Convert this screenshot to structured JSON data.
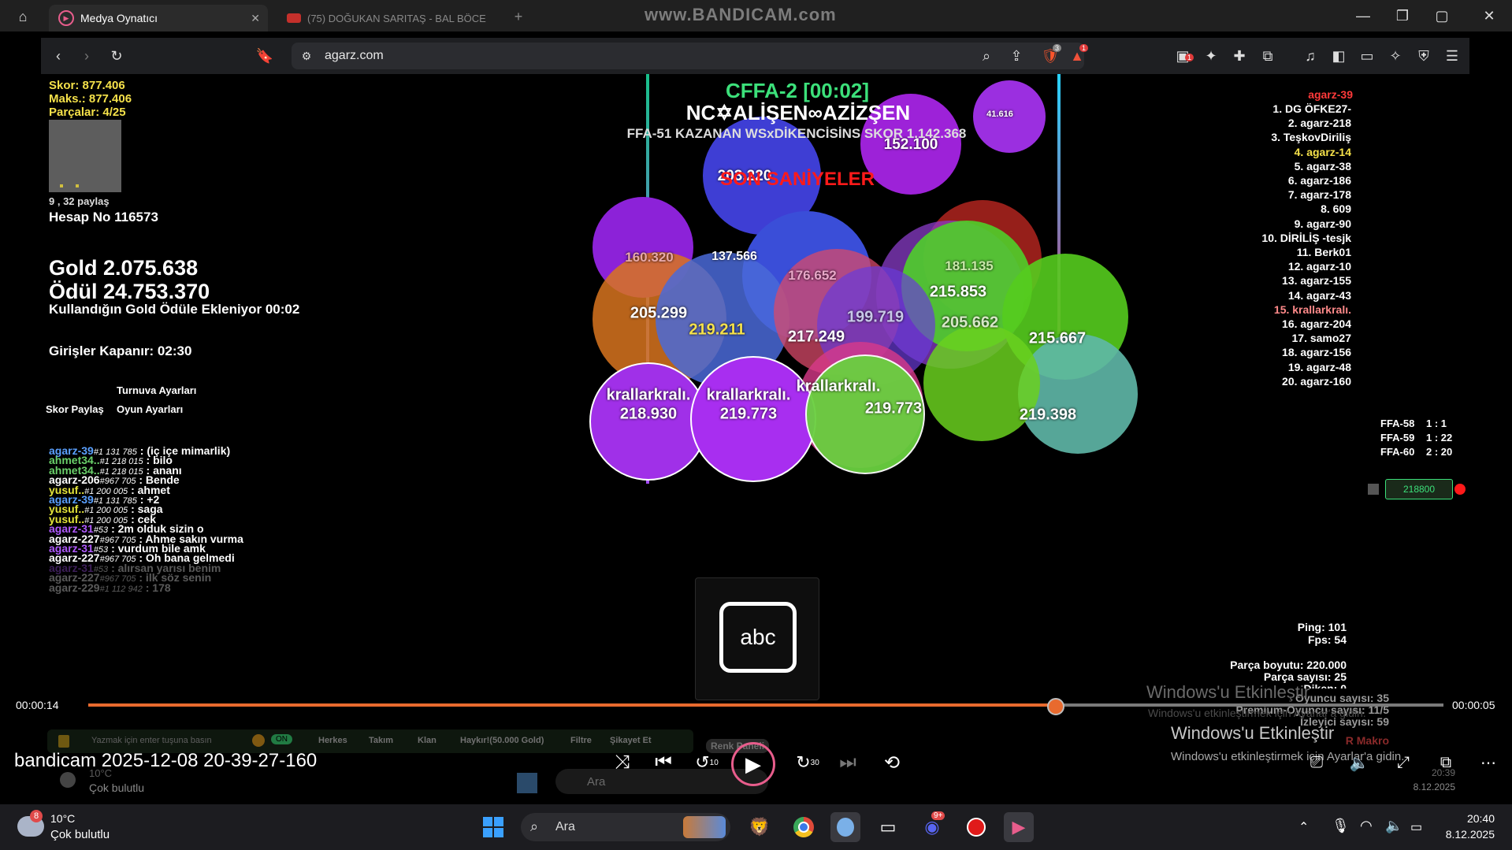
{
  "watermark": "www.BANDICAM.com",
  "titlebar": {
    "tabs": [
      {
        "label": "Medya Oynatıcı",
        "active": true
      },
      {
        "label": "(75) DOĞUKAN SARITAŞ - BAL BÖCE",
        "active": false
      }
    ],
    "new_tab": "+"
  },
  "browser": {
    "url": "agarz.com",
    "shield_badge": "3",
    "alert_badge": "1",
    "ext_badge": "1"
  },
  "hud": {
    "score": "Skor: 877.406",
    "max": "Maks.: 877.406",
    "pieces": "Parçalar: 4/25",
    "share_info": "9 , 32 paylaş",
    "account": "Hesap No 116573",
    "gold": "Gold 2.075.638",
    "award": "Ödül 24.753.370",
    "gold_note": "Kullandığın Gold Ödüle Ekleniyor 00:02",
    "entries_close": "Girişler Kapanır: 02:30",
    "tournament_settings": "Turnuva Ayarları",
    "score_share": "Skor Paylaş",
    "game_settings": "Oyun Ayarları"
  },
  "center": {
    "mode_timer": "CFFA-2 [00:02]",
    "room_name": "NC✡ALİŞEN∞AZİZŞEN",
    "winner_line": "FFA-51 KAZANAN WSxDİKENCİSİNS SKOR 1.142.368",
    "last_seconds": "SON SANİYELER"
  },
  "blobs": {
    "labels": [
      {
        "text": "41.616"
      },
      {
        "text": "152.100"
      },
      {
        "text": "203.220"
      },
      {
        "text": "160.320"
      },
      {
        "text": "137.566"
      },
      {
        "text": "176.652"
      },
      {
        "text": "181.135"
      },
      {
        "text": "215.853"
      },
      {
        "text": "205.299"
      },
      {
        "text": "219.211"
      },
      {
        "text": "217.249"
      },
      {
        "text": "199.719"
      },
      {
        "text": "205.662"
      },
      {
        "text": "215.667"
      },
      {
        "text": "219.398"
      }
    ],
    "players": [
      {
        "name": "krallarkralı.",
        "mass": "218.930"
      },
      {
        "name": "krallarkralı.",
        "mass": "219.773"
      },
      {
        "name": "krallarkralı.",
        "mass": "219.773"
      }
    ]
  },
  "leaderboard": {
    "me": "agarz-39",
    "items": [
      "1. DG ÖFKE27-",
      "2. agarz-218",
      "3. TeşkovDiriliş",
      "4. agarz-14",
      "5. agarz-38",
      "6. agarz-186",
      "7. agarz-178",
      "8. 609",
      "9. agarz-90",
      "10. DİRİLİŞ -tesjk",
      "11. Berk01",
      "12. agarz-10",
      "13. agarz-155",
      "14. agarz-43",
      "15. krallarkralı.",
      "16. agarz-204",
      "17. samo27",
      "18. agarz-156",
      "19. agarz-48",
      "20. agarz-160"
    ],
    "highlight_colors": {
      "3": "#f5e14a",
      "14": "#ff8a8a"
    }
  },
  "ffa": [
    {
      "name": "FFA-58",
      "value": "1 : 1"
    },
    {
      "name": "FFA-59",
      "value": "1 : 22"
    },
    {
      "name": "FFA-60",
      "value": "2 : 20"
    }
  ],
  "mass_box": "218800",
  "stats": {
    "ping": "Ping: 101",
    "fps": "Fps: 54",
    "piece_size": "Parça boyutu: 220.000",
    "piece_count": "Parça sayısı: 25",
    "spike": "Diken: 0",
    "players": "Oyuncu sayısı: 35",
    "premium": "Premium-Oyuncu sayısı: 11/5",
    "spectators": "İzleyici sayısı: 59",
    "r_macro": "R Makro"
  },
  "chat": [
    {
      "name": "agarz-39",
      "tag": "#1 131 785",
      "msg": ": (iç içe mimarlik)",
      "color": "#5aa0ff"
    },
    {
      "name": "ahmet34..",
      "tag": "#1 218 015",
      "msg": ": bilo",
      "color": "#6ad06a"
    },
    {
      "name": "ahmet34..",
      "tag": "#1 218 015",
      "msg": ": ananı",
      "color": "#6ad06a"
    },
    {
      "name": "agarz-206",
      "tag": "#967 705",
      "msg": ": Bende",
      "color": "#ffffff"
    },
    {
      "name": "yusuf..",
      "tag": "#1 200 005",
      "msg": ": ahmet",
      "color": "#e4e43a"
    },
    {
      "name": "agarz-39",
      "tag": "#1 131 785",
      "msg": ": +2",
      "color": "#5aa0ff"
    },
    {
      "name": "yusuf..",
      "tag": "#1 200 005",
      "msg": ": saga",
      "color": "#e4e43a"
    },
    {
      "name": "yusuf..",
      "tag": "#1 200 005",
      "msg": ": cek",
      "color": "#e4e43a"
    },
    {
      "name": "agarz-31",
      "tag": "#53",
      "msg": ": 2m olduk sizin o",
      "color": "#b05aff"
    },
    {
      "name": "agarz-227",
      "tag": "#967 705",
      "msg": ": Ahme sakın vurma",
      "color": "#ffffff"
    },
    {
      "name": "agarz-31",
      "tag": "#53",
      "msg": ": vurdum bile amk",
      "color": "#b05aff"
    },
    {
      "name": "agarz-227",
      "tag": "#967 705",
      "msg": ": Oh bana gelmedi",
      "color": "#ffffff"
    },
    {
      "name": "agarz-31",
      "tag": "#53",
      "msg": ": alırsan yarısı benim",
      "color": "#b05aff"
    },
    {
      "name": "agarz-227",
      "tag": "#967 705",
      "msg": ": ilk söz senin",
      "color": "#ffffff"
    },
    {
      "name": "agarz-229",
      "tag": "#1 112 942",
      "msg": ": 178",
      "color": "#ffffff"
    }
  ],
  "chat_bar": {
    "placeholder": "Yazmak için enter tuşuna basın",
    "toggle": "ON",
    "filters": [
      "Herkes",
      "Takım",
      "Klan",
      "Haykır!(50.000 Gold)",
      "Filtre",
      "Şikayet Et"
    ],
    "color_panel": "Renk Paneli"
  },
  "player": {
    "keyboard_icon_label": "abc",
    "elapsed": "00:00:14",
    "remaining": "00:00:05",
    "progress": 0.713,
    "file_title": "bandicam 2025-12-08 20-39-27-160",
    "rewind_label": "10",
    "forward_label": "30"
  },
  "activation": {
    "title": "Windows'u Etkinleştir",
    "subtitle": "Windows'u etkinleştirmek için Ayarlar'a gidin."
  },
  "inner_taskbar": {
    "weather_temp": "10°C",
    "weather_desc": "Çok bulutlu",
    "search": "Ara",
    "time": "20:39",
    "date": "8.12.2025"
  },
  "taskbar": {
    "weather_badge": "8",
    "weather_temp": "10°C",
    "weather_desc": "Çok bulutlu",
    "search": "Ara",
    "discord_badge": "9+",
    "time": "20:40",
    "date": "8.12.2025"
  }
}
